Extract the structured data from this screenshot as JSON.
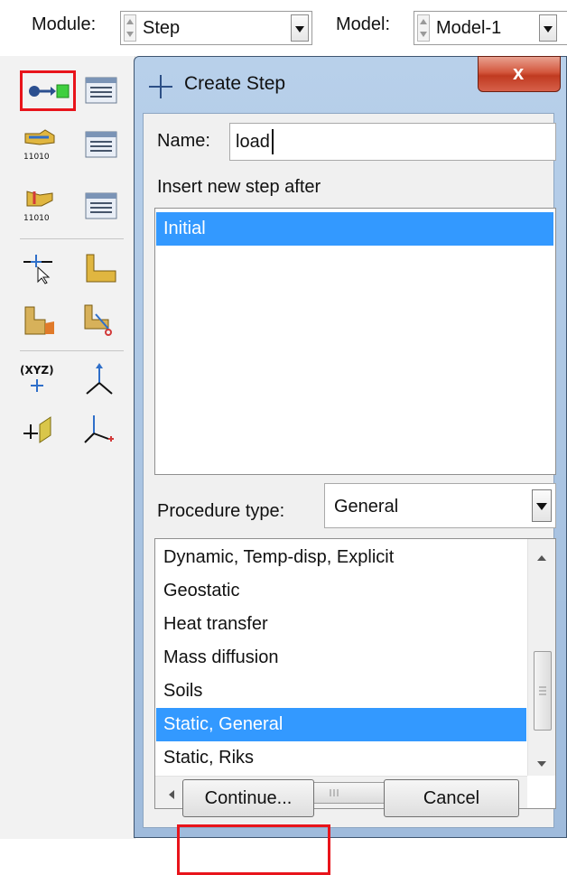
{
  "toolbar": {
    "module_label": "Module:",
    "module_value": "Step",
    "model_label": "Model:",
    "model_value": "Model-1"
  },
  "toolbox": {
    "tools": [
      "create-step-icon",
      "step-manager-icon",
      "field-output-icon",
      "field-output-manager-icon",
      "history-output-icon",
      "history-output-manager-icon",
      "select-region-icon",
      "set-icon",
      "partition-cell-icon",
      "partition-edge-icon",
      "datum-point-icon",
      "datum-axis-icon",
      "datum-plane-icon",
      "datum-csys-icon"
    ],
    "highlight_color": "#e8141b"
  },
  "dialog": {
    "title": "Create Step",
    "close_glyph": "x",
    "name_label": "Name:",
    "name_value": "load",
    "insert_label": "Insert new step after",
    "insert_items": [
      "Initial"
    ],
    "insert_selected": "Initial",
    "procedure_label": "Procedure type:",
    "procedure_value": "General",
    "procedures": [
      "Dynamic, Temp-disp, Explicit",
      "Geostatic",
      "Heat transfer",
      "Mass diffusion",
      "Soils",
      "Static, General",
      "Static, Riks"
    ],
    "procedure_selected": "Static, General",
    "continue_label": "Continue...",
    "cancel_label": "Cancel",
    "selection_color": "#3399ff"
  }
}
